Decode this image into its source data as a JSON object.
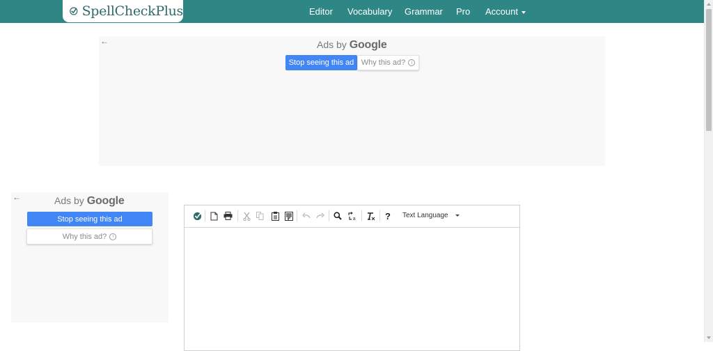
{
  "brand": {
    "name": "SpellCheckPlus",
    "color": "#2e8784"
  },
  "nav": {
    "items": [
      {
        "label": "Editor"
      },
      {
        "label": "Vocabulary"
      },
      {
        "label": "Grammar"
      },
      {
        "label": "Pro"
      },
      {
        "label": "Account"
      }
    ]
  },
  "ads": {
    "top": {
      "back_icon": "arrow-left-icon",
      "prefix": "Ads by",
      "brand": "Google",
      "stop_label": "Stop seeing this ad",
      "why_label": "Why this ad?"
    },
    "left": {
      "back_icon": "arrow-left-icon",
      "prefix": "Ads by",
      "brand": "Google",
      "stop_label": "Stop seeing this ad",
      "why_label": "Why this ad?"
    },
    "button_color": "#4285f4"
  },
  "editor": {
    "toolbar": {
      "buttons": [
        "check-icon",
        "new-document-icon",
        "print-icon",
        "cut-icon",
        "copy-icon",
        "paste-icon",
        "paste-text-icon",
        "undo-icon",
        "redo-icon",
        "find-icon",
        "replace-icon",
        "remove-format-icon",
        "help-icon"
      ],
      "language_label": "Text Language"
    },
    "content": ""
  }
}
